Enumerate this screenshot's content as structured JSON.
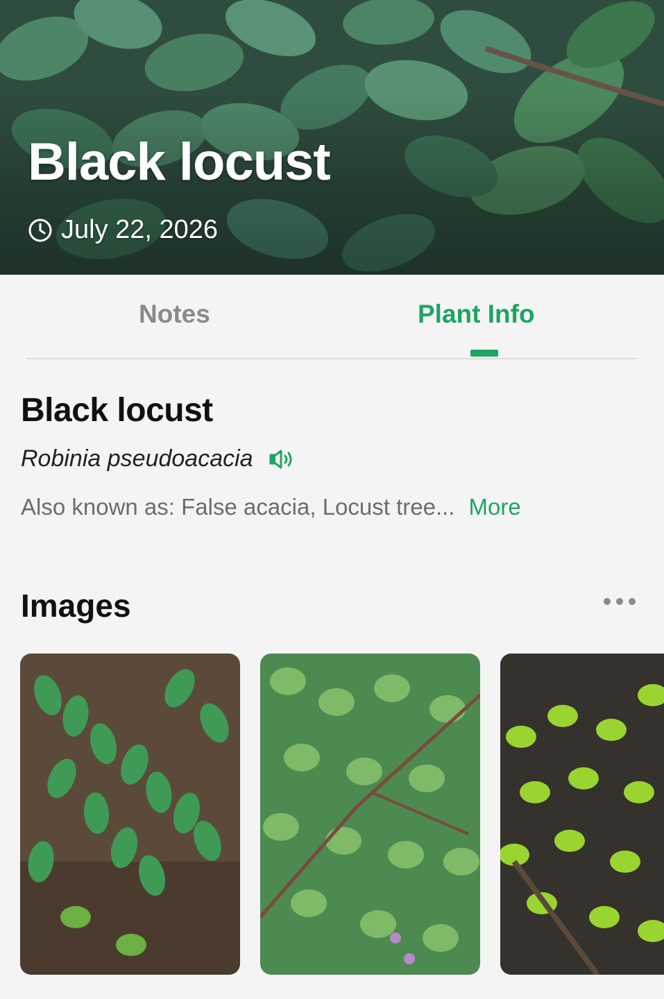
{
  "hero": {
    "title": "Black locust",
    "date": "July 22, 2026",
    "date_icon": "clock-icon"
  },
  "tabs": [
    {
      "label": "Notes",
      "active": false
    },
    {
      "label": "Plant Info",
      "active": true
    }
  ],
  "plant": {
    "common_name": "Black locust",
    "scientific_name": "Robinia pseudoacacia",
    "pronounce_icon": "speaker-icon",
    "also_known_as": "Also known as: False acacia, Locust tree...",
    "more_label": "More"
  },
  "images_section": {
    "heading": "Images",
    "menu_icon": "ellipsis-icon",
    "thumbnails": [
      {
        "name": "image-thumbnail-1"
      },
      {
        "name": "image-thumbnail-2"
      },
      {
        "name": "image-thumbnail-3"
      }
    ]
  },
  "colors": {
    "accent_green": "#1ea463",
    "inactive_tab": "#8a8a8a",
    "background": "#f4f4f4"
  }
}
